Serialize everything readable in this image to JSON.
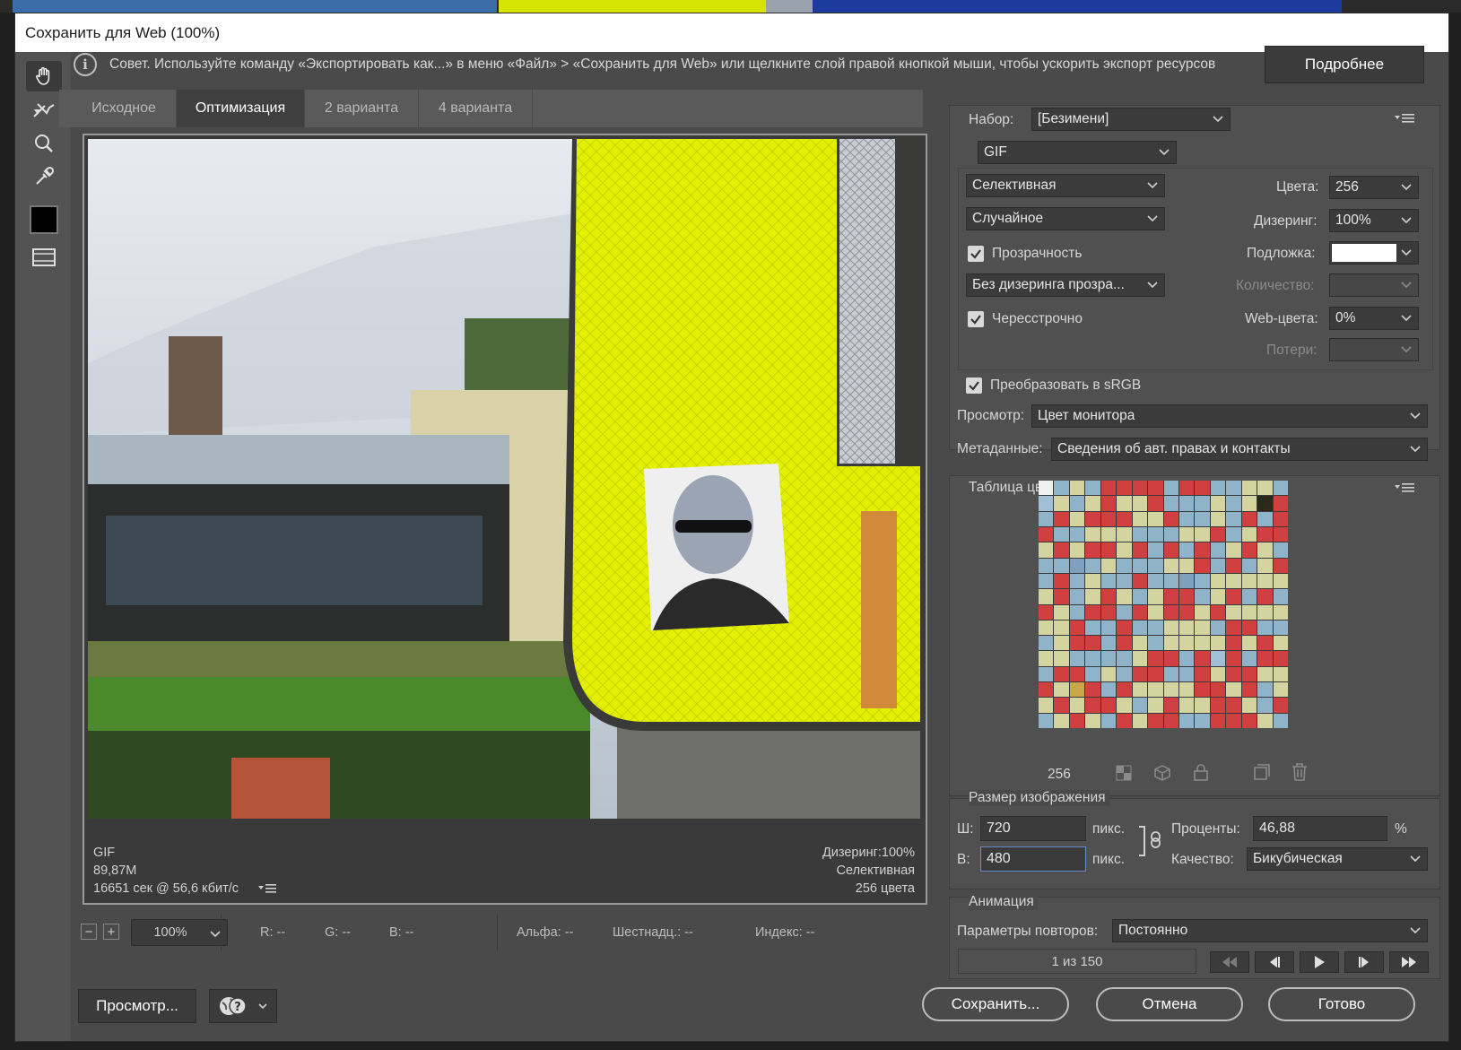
{
  "title": "Сохранить для Web (100%)",
  "tip": {
    "text": "Совет. Используйте команду «Экспортировать как...» в меню «Файл» > «Сохранить для Web» или щелкните слой правой кнопкой мыши, чтобы ускорить экспорт ресурсов",
    "more_label": "Подробнее"
  },
  "tools": [
    "hand-tool",
    "slice-select-tool",
    "zoom-tool",
    "eyedropper-tool",
    "eyedropper-color",
    "toggle-slices"
  ],
  "tabs": [
    {
      "label": "Исходное",
      "active": false
    },
    {
      "label": "Оптимизация",
      "active": true
    },
    {
      "label": "2 варианта",
      "active": false
    },
    {
      "label": "4 варианта",
      "active": false
    }
  ],
  "viewer": {
    "format": "GIF",
    "size": "89,87M",
    "time": "16651 сек @ 56,6 кбит/с",
    "dither_info": "Дизеринг:100%",
    "palette_info": "Селективная",
    "colors_info": "256 цвета"
  },
  "statusbar": {
    "zoom": "100%",
    "r": "R: --",
    "g": "G: --",
    "b": "B: --",
    "alpha": "Альфа: --",
    "hex": "Шестнадц.: --",
    "index": "Индекс: --"
  },
  "buttons": {
    "preview": "Просмотр...",
    "save": "Сохранить...",
    "cancel": "Отмена",
    "done": "Готово"
  },
  "settings": {
    "preset_label": "Набор:",
    "preset_value": "[Безимени]",
    "format": "GIF",
    "reduction": "Селективная",
    "dither_algo": "Случайное",
    "transparency_label": "Прозрачность",
    "transparency_checked": true,
    "trans_dither": "Без дизеринга прозра...",
    "interlaced_label": "Чересстрочно",
    "interlaced_checked": true,
    "colors_label": "Цвета:",
    "colors_value": "256",
    "dither_label": "Дизеринг:",
    "dither_value": "100%",
    "matte_label": "Подложка:",
    "matte_color": "#ffffff",
    "amount_label": "Количество:",
    "web_label": "Web-цвета:",
    "web_value": "0%",
    "lossy_label": "Потери:",
    "srgb_label": "Преобразовать в sRGB",
    "srgb_checked": true,
    "preview_label": "Просмотр:",
    "preview_value": "Цвет монитора",
    "metadata_label": "Метаданные:",
    "metadata_value": "Сведения об авт. правах и контакты"
  },
  "color_table": {
    "title": "Таблица цветов",
    "count": "256"
  },
  "image_size": {
    "title": "Размер изображения",
    "w_label": "Ш:",
    "w_value": "720",
    "h_label": "В:",
    "h_value": "480",
    "unit": "пикс.",
    "percent_label": "Проценты:",
    "percent_value": "46,88",
    "percent_sign": "%",
    "quality_label": "Качество:",
    "quality_value": "Бикубическая"
  },
  "animation": {
    "title": "Анимация",
    "loop_label": "Параметры повторов:",
    "loop_value": "Постоянно",
    "frame": "1 из 150"
  },
  "colors": {
    "accent_yellow": "#e3f000",
    "bg": "#4a4a4a"
  }
}
